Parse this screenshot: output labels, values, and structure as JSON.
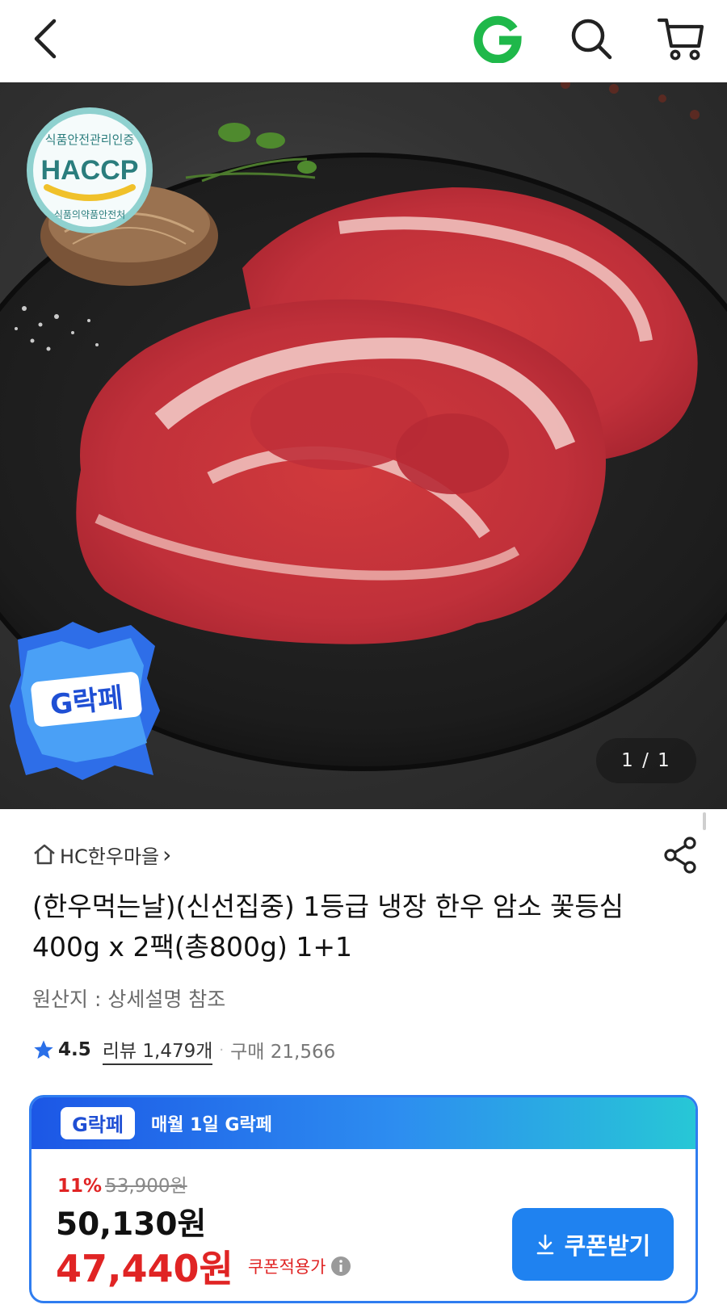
{
  "topbar": {
    "back_icon": "chevron-left-icon",
    "logo_letter": "G",
    "search_icon": "search-icon",
    "cart_icon": "cart-icon"
  },
  "hero": {
    "certification_top": "식품안전관리인증",
    "certification_main": "HACCP",
    "certification_bottom": "식품의약품안전처",
    "promo_badge": "G락페",
    "counter": "1 / 1"
  },
  "product": {
    "seller": "HC한우마을",
    "seller_arrow": "›",
    "title": "(한우먹는날)(신선집중) 1등급 냉장 한우 암소 꽃등심 400g x 2팩(총800g) 1+1",
    "origin": "원산지 : 상세설명 참조",
    "rating": "4.5",
    "review": "리뷰 1,479개",
    "separator": "·",
    "purchase": "구매 21,566"
  },
  "promo_card": {
    "badge": "G락페",
    "header": "매월 1일 G락페",
    "discount_percent": "11%",
    "original_price": "53,900원",
    "price": "50,130원",
    "coupon_price": "47,440원",
    "coupon_label": "쿠폰적용가",
    "coupon_button": "쿠폰받기"
  },
  "colors": {
    "accent_blue": "#1f82f0",
    "sale_red": "#e02424",
    "logo_green": "#1fb84a"
  }
}
